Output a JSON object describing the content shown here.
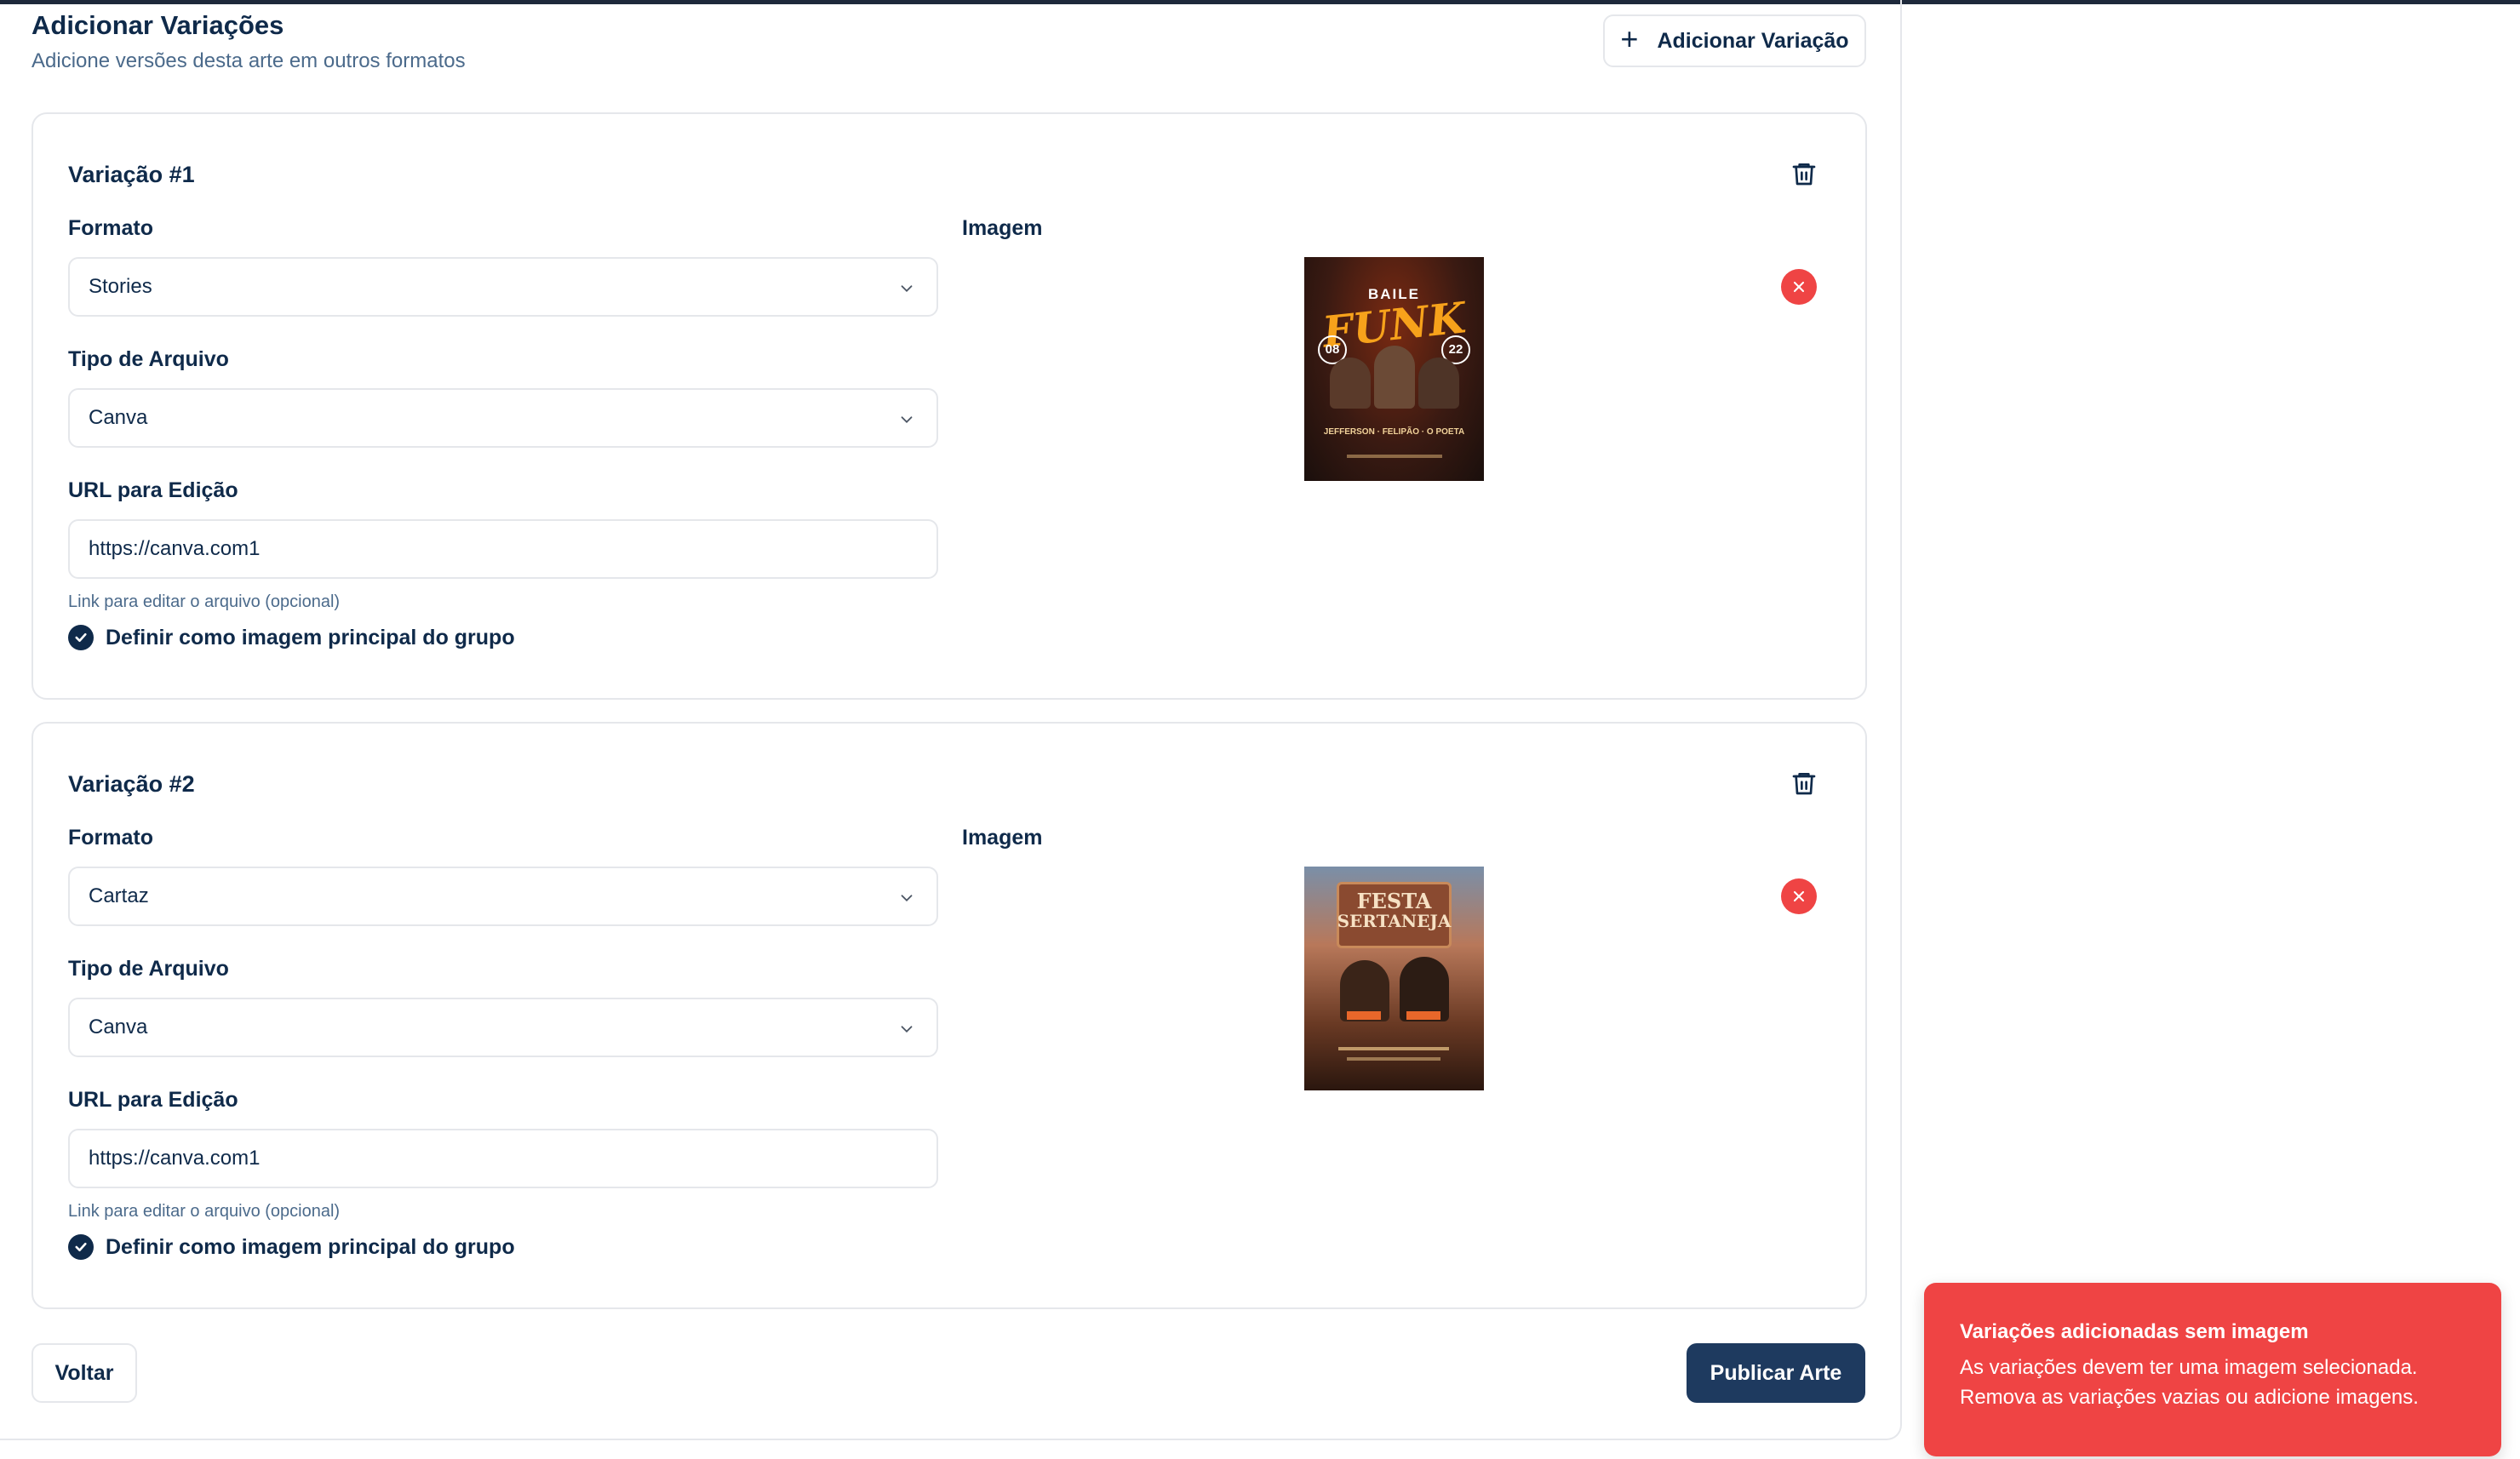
{
  "header": {
    "title": "Adicionar Variações",
    "subtitle": "Adicione versões desta arte em outros formatos",
    "add_button_label": "Adicionar Variação"
  },
  "variations": [
    {
      "title": "Variação #1",
      "format_label": "Formato",
      "format_value": "Stories",
      "file_type_label": "Tipo de Arquivo",
      "file_type_value": "Canva",
      "url_label": "URL para Edição",
      "url_value": "https://canva.com1",
      "url_hint": "Link para editar o arquivo (opcional)",
      "image_label": "Imagem",
      "main_image_label": "Definir como imagem principal do grupo",
      "main_image_checked": true,
      "poster": {
        "top": "BAILE",
        "big": "FUNK",
        "left_date": "08",
        "right_date": "22",
        "names": "JEFFERSON · FELIPÃO · O POETA"
      }
    },
    {
      "title": "Variação #2",
      "format_label": "Formato",
      "format_value": "Cartaz",
      "file_type_label": "Tipo de Arquivo",
      "file_type_value": "Canva",
      "url_label": "URL para Edição",
      "url_value": "https://canva.com1",
      "url_hint": "Link para editar o arquivo (opcional)",
      "image_label": "Imagem",
      "main_image_label": "Definir como imagem principal do grupo",
      "main_image_checked": true,
      "poster": {
        "line1": "FESTA",
        "line2": "SERTANEJA"
      }
    }
  ],
  "footer": {
    "back_label": "Voltar",
    "publish_label": "Publicar Arte"
  },
  "toast": {
    "title": "Variações adicionadas sem imagem",
    "line1": "As variações devem ter uma imagem selecionada.",
    "line2": "Remova as variações vazias ou adicione imagens."
  },
  "colors": {
    "primary": "#1e3a5f",
    "danger": "#ef4444",
    "text": "#0f2a4a",
    "muted": "#4b6a8b",
    "border": "#e5e7eb"
  }
}
